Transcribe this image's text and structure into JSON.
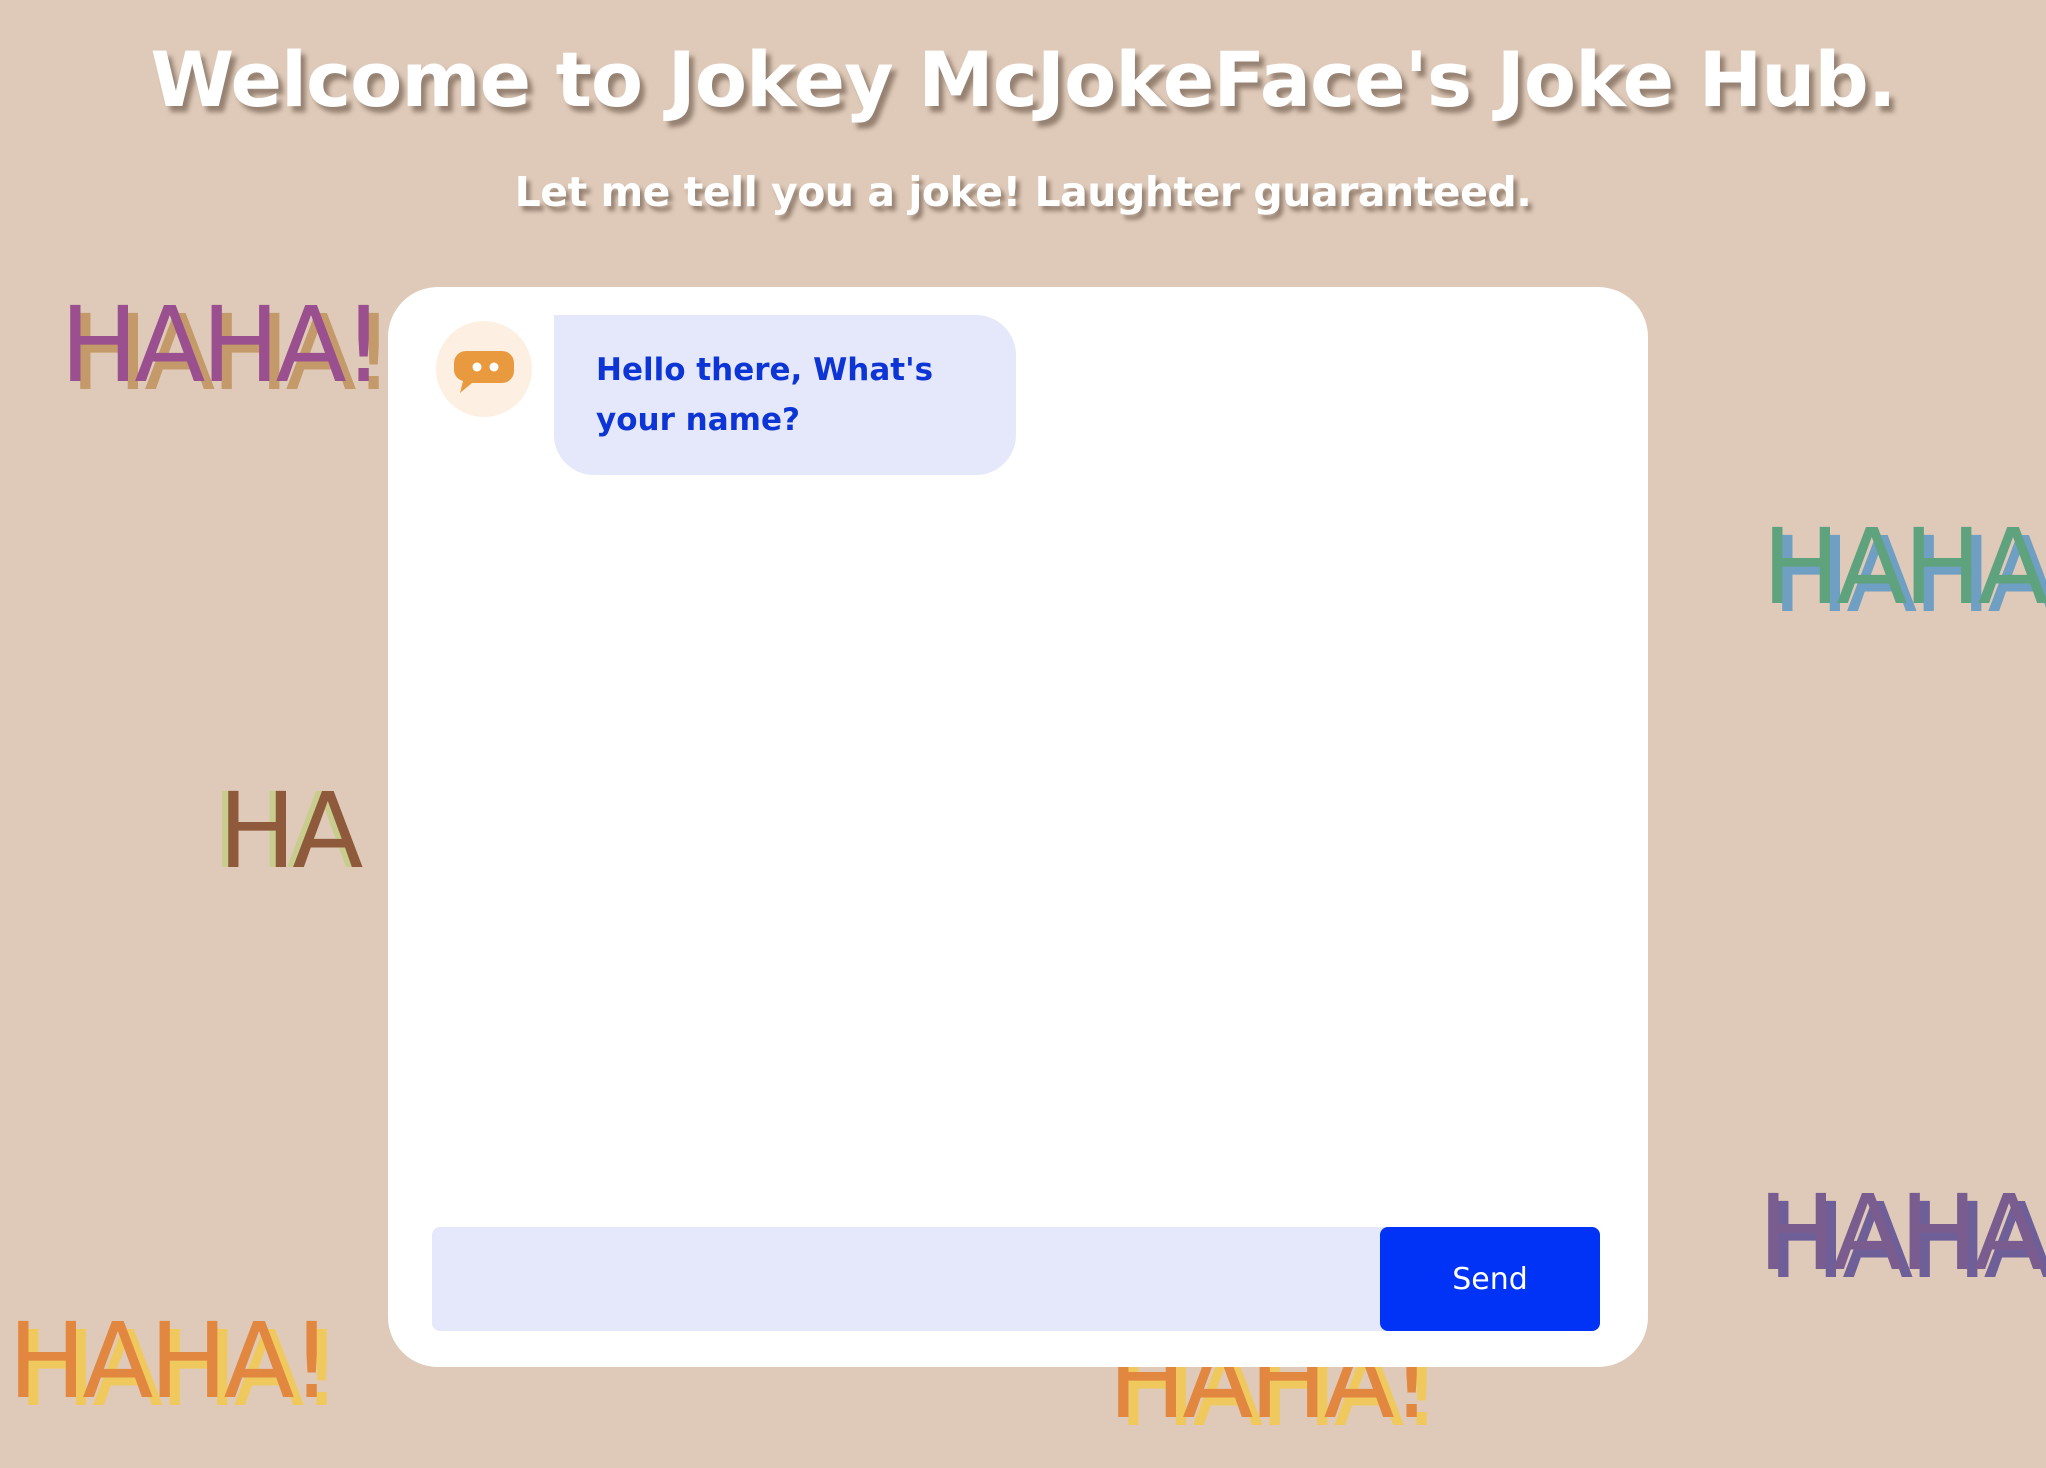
{
  "header": {
    "title": "Welcome to Jokey McJokeFace's Joke Hub.",
    "subtitle": "Let me tell you a joke! Laughter guaranteed."
  },
  "background": {
    "stamps": [
      "HAHA!",
      "HAHA",
      "HA",
      "HAHA",
      "HAHA!",
      "HAHA!"
    ]
  },
  "chat": {
    "avatar_icon": "chat-bubble-icon",
    "messages": [
      {
        "from": "bot",
        "text": "Hello there, What's your name?"
      }
    ],
    "input": {
      "value": "",
      "placeholder": ""
    },
    "send_label": "Send"
  },
  "colors": {
    "background": "#dfcab9",
    "card": "#ffffff",
    "bubble": "#e5e8fa",
    "bubble_text": "#0d35d6",
    "send_button": "#0033f5",
    "avatar_icon": "#ea9a3e"
  }
}
